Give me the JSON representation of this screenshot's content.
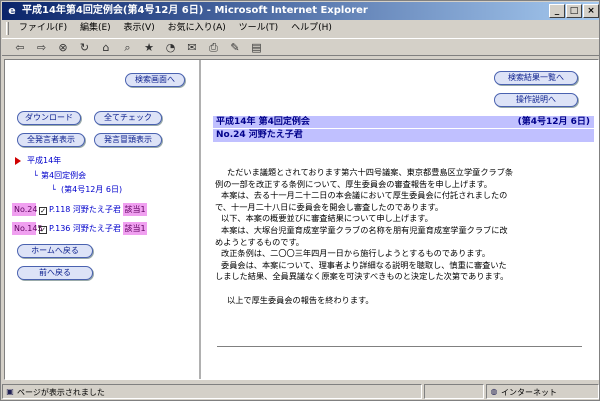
{
  "window": {
    "title": "平成14年第4回定例会(第4号12月 6日) - Microsoft Internet Explorer",
    "min_label": "_",
    "max_label": "□",
    "close_label": "×"
  },
  "menu": [
    "ファイル(F)",
    "編集(E)",
    "表示(V)",
    "お気に入り(A)",
    "ツール(T)",
    "ヘルプ(H)"
  ],
  "left": {
    "search_screen": "検索画面へ",
    "download": "ダウンロード",
    "check_all": "全てチェック",
    "show_all_speakers": "全発言者表示",
    "show_speech_head": "発言冒頭表示",
    "tree": {
      "year": "平成14年",
      "session": "第4回定例会",
      "issue": "(第4号12月 6日)"
    },
    "hits": [
      {
        "no": "No.24",
        "page": "P.118 河野たえ子君",
        "hit": "該当1"
      },
      {
        "no": "No.145",
        "page": "P.136 河野たえ子君",
        "hit": "該当1"
      }
    ],
    "home": "ホームへ戻る",
    "back": "前へ戻る"
  },
  "right": {
    "results_list": "検索結果一覧へ",
    "help": "操作説明へ",
    "header_title": "平成14年 第4回定例会",
    "header_issue": "(第4号12月 6日)",
    "speaker": "No.24 河野たえ子君",
    "body": [
      "ただいま議題とされております第六十四号議案、東京都豊島区立学童クラブ条",
      "例の一部を改正する条例について、厚生委員会の審査報告を申し上げます。",
      "本案は、去る十一月二十二日の本会議において厚生委員会に付託されましたの",
      "で、十一月二十八日に委員会を開会し審査したのであります。",
      "以下、本案の概要並びに審査結果について申し上げます。",
      "本案は、大塚台児童育成室学童クラブの名称を朋有児童育成室学童クラブに改",
      "めようとするものです。",
      "改正条例は、二〇〇三年四月一日から施行しようとするものであります。",
      "委員会は、本案について、理事者より詳細なる説明を聴取し、慎重に審査いた",
      "しました結果、全員異議なく原案を可決すべきものと決定した次第であります。",
      "",
      "以上で厚生委員会の報告を終わります。"
    ]
  },
  "status": {
    "left": "ページが表示されました",
    "zone": "インターネット"
  }
}
